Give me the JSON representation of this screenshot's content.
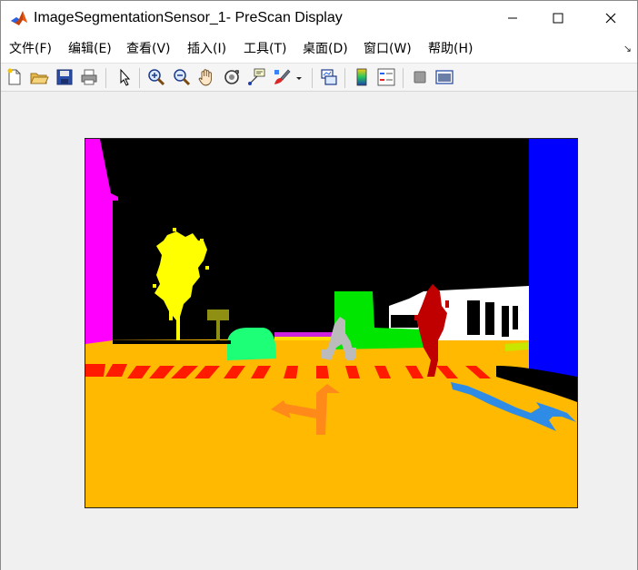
{
  "window": {
    "title": "ImageSegmentationSensor_1- PreScan Display",
    "icon": "matlab-icon",
    "controls": [
      "minimize-icon",
      "maximize-icon",
      "close-icon"
    ]
  },
  "menubar": {
    "items": [
      {
        "label": "文件(F)"
      },
      {
        "label": "编辑(E)"
      },
      {
        "label": "查看(V)"
      },
      {
        "label": "插入(I)"
      },
      {
        "label": "工具(T)"
      },
      {
        "label": "桌面(D)"
      },
      {
        "label": "窗口(W)"
      },
      {
        "label": "帮助(H)"
      }
    ],
    "corner_icon": "dock-arrow-icon",
    "corner_glyph": "↘"
  },
  "toolbar": {
    "buttons": [
      "new-figure-icon",
      "open-file-icon",
      "save-icon",
      "print-icon",
      "select-pointer-icon",
      "zoom-in-icon",
      "zoom-out-icon",
      "pan-hand-icon",
      "rotate-3d-icon",
      "data-cursor-icon",
      "brush-icon",
      "brush-dropdown-icon",
      "link-plot-icon",
      "insert-colorbar-icon",
      "insert-legend-icon",
      "hide-plot-tools-icon",
      "show-plot-tools-icon"
    ]
  },
  "scene": {
    "description_colors": {
      "sky": "#000000",
      "road": "#ffb900",
      "crosswalk": "#ff1a00",
      "building_left": "#ff00ff",
      "building_right": "#0000ff",
      "tree": "#ffff00",
      "car": "#1eff78",
      "bus": "#00e600",
      "pedestrian": "#c00000",
      "cyclist": "#bbbbbb",
      "sign": "#8f8f14",
      "arrow_marking": "#ff8a1a",
      "shadow_marking": "#2f8ce6",
      "white_building": "#ffffff"
    }
  }
}
